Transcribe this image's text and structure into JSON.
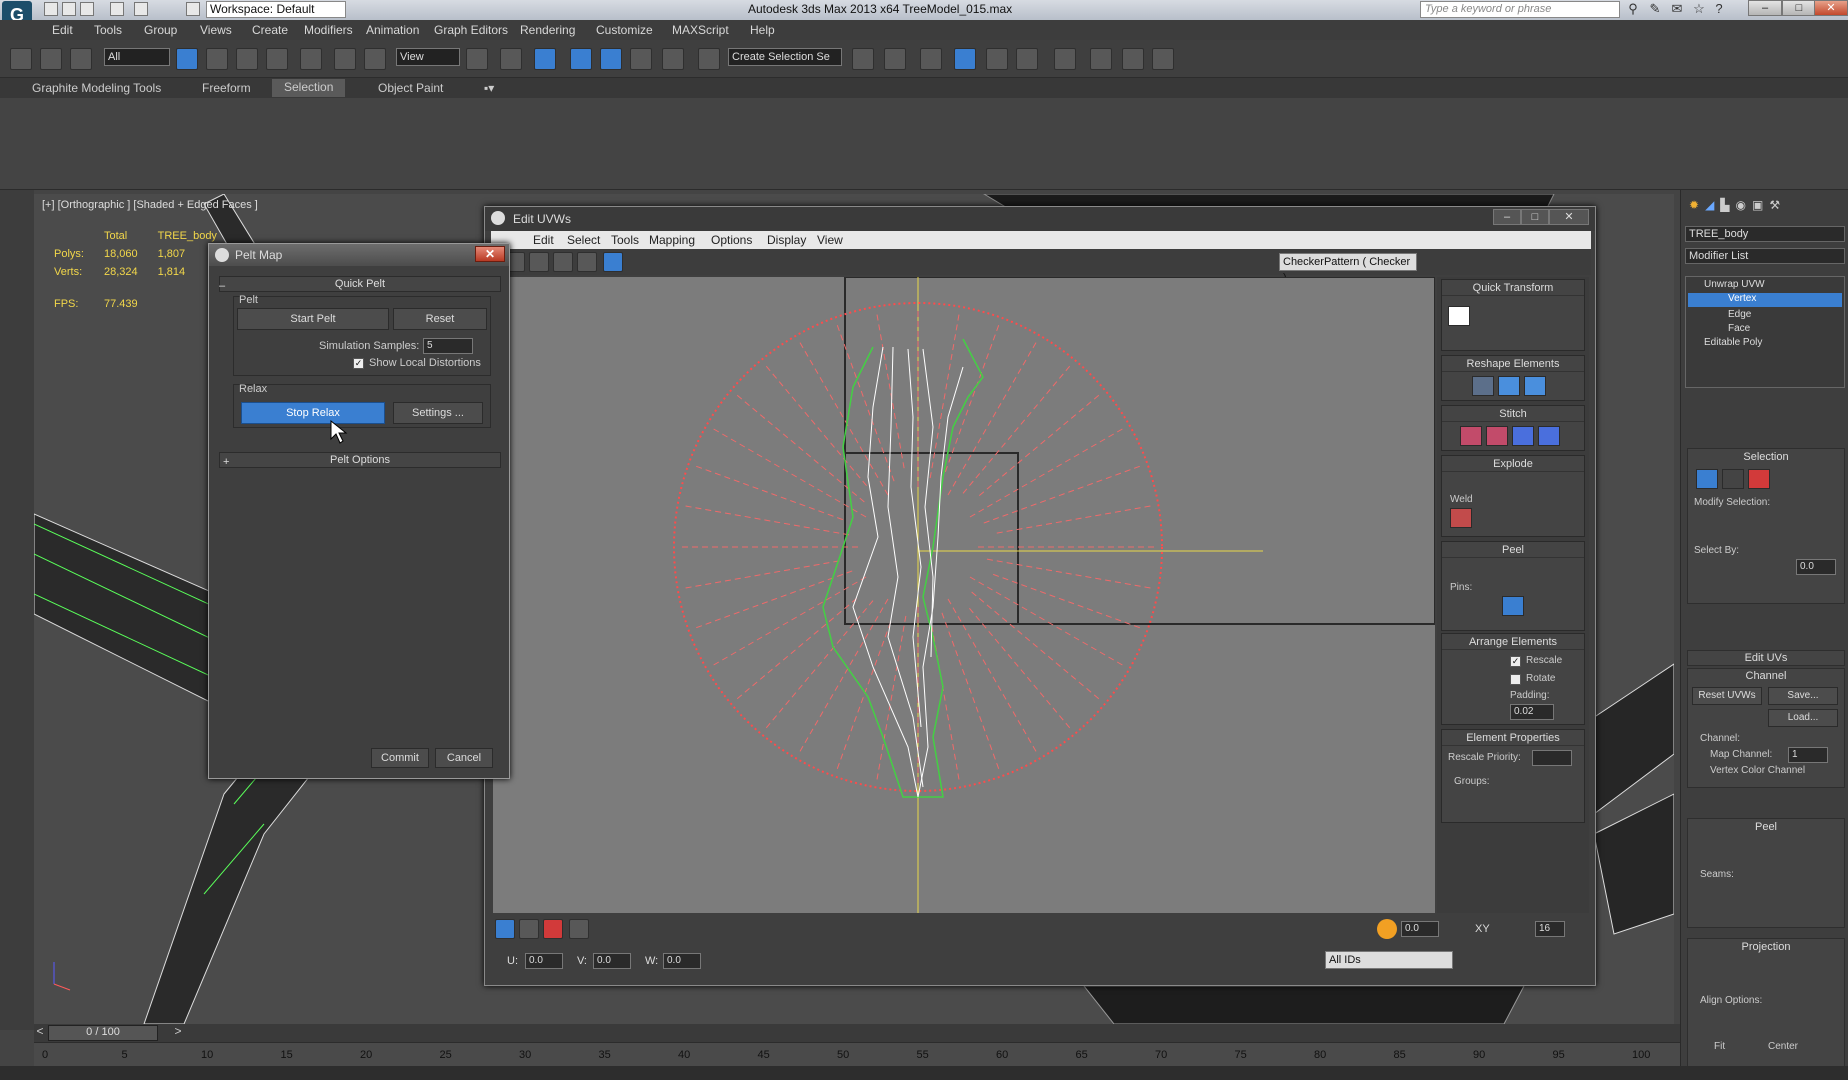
{
  "titlebar": {
    "workspace": "Workspace: Default",
    "title": "Autodesk 3ds Max  2013 x64     TreeModel_015.max",
    "search_placeholder": "Type a keyword or phrase"
  },
  "menu": [
    "Edit",
    "Tools",
    "Group",
    "Views",
    "Create",
    "Modifiers",
    "Animation",
    "Graph Editors",
    "Rendering",
    "Customize",
    "MAXScript",
    "Help"
  ],
  "toolbar": {
    "selection_filter": "All",
    "ref_coord": "View",
    "named_selection": "Create Selection Se"
  },
  "ribbon": {
    "tabs": [
      "Graphite Modeling Tools",
      "Freeform",
      "Selection",
      "Object Paint"
    ],
    "active": "Selection"
  },
  "viewport": {
    "label": "[+] [Orthographic ] [Shaded + Edged Faces ]",
    "stats": {
      "col_total": "Total",
      "col_obj": "TREE_body",
      "polys_label": "Polys:",
      "polys_total": "18,060",
      "polys_obj": "1,807",
      "verts_label": "Verts:",
      "verts_total": "28,324",
      "verts_obj": "1,814",
      "fps_label": "FPS:",
      "fps": "77.439"
    }
  },
  "uvw": {
    "title": "Edit UVWs",
    "menu": [
      "Edit",
      "Select",
      "Tools",
      "Mapping",
      "Options",
      "Display",
      "View"
    ],
    "texture": "CheckerPattern  ( Checker )",
    "rollouts": {
      "quick_transform": "Quick Transform",
      "reshape": "Reshape Elements",
      "stitch": "Stitch",
      "explode": "Explode",
      "weld": "Weld",
      "peel": "Peel",
      "pins": "Pins:",
      "arrange": "Arrange Elements",
      "rescale": "Rescale",
      "rotate": "Rotate",
      "padding_label": "Padding:",
      "padding": "0.02",
      "elem_props": "Element Properties",
      "rescale_priority": "Rescale Priority:",
      "groups": "Groups:"
    },
    "bottom": {
      "u_label": "U:",
      "u": "0.0",
      "v_label": "V:",
      "v": "0.0",
      "w_label": "W:",
      "w": "0.0",
      "soft": "0.0",
      "xy": "XY",
      "grid": "16",
      "ids": "All IDs"
    }
  },
  "pelt": {
    "title": "Pelt Map",
    "quick_pelt": "Quick Pelt",
    "pelt_group": "Pelt",
    "start_pelt": "Start Pelt",
    "reset": "Reset",
    "sim_samples_label": "Simulation Samples:",
    "sim_samples": "5",
    "show_local": "Show Local Distortions",
    "relax_group": "Relax",
    "stop_relax": "Stop Relax",
    "settings": "Settings ...",
    "pelt_options": "Pelt Options",
    "commit": "Commit",
    "cancel": "Cancel"
  },
  "cmdpanel": {
    "object_name": "TREE_body",
    "modifier_list": "Modifier List",
    "stack": [
      "Unwrap UVW",
      "Vertex",
      "Edge",
      "Face",
      "Editable Poly"
    ],
    "selection": "Selection",
    "modify_selection": "Modify Selection:",
    "select_by": "Select By:",
    "select_by_val": "0.0",
    "edit_uvs": "Edit UVs",
    "channel": "Channel",
    "reset_uvws": "Reset UVWs",
    "save": "Save...",
    "load": "Load...",
    "channel_label": "Channel:",
    "map_channel": "Map Channel:",
    "map_channel_val": "1",
    "vertex_color": "Vertex Color Channel",
    "peel": "Peel",
    "seams": "Seams:",
    "projection": "Projection",
    "align_options": "Align Options:",
    "fit": "Fit",
    "center": "Center"
  },
  "timeline": {
    "frame": "0 / 100",
    "ticks": [
      "0",
      "5",
      "10",
      "15",
      "20",
      "25",
      "30",
      "35",
      "40",
      "45",
      "50",
      "55",
      "60",
      "65",
      "70",
      "75",
      "80",
      "85",
      "90",
      "95",
      "100"
    ]
  },
  "colors": {
    "accent": "#3a7fd1",
    "red": "#e03a3a",
    "green": "#2fd12f",
    "yellow": "#e8d84a"
  }
}
